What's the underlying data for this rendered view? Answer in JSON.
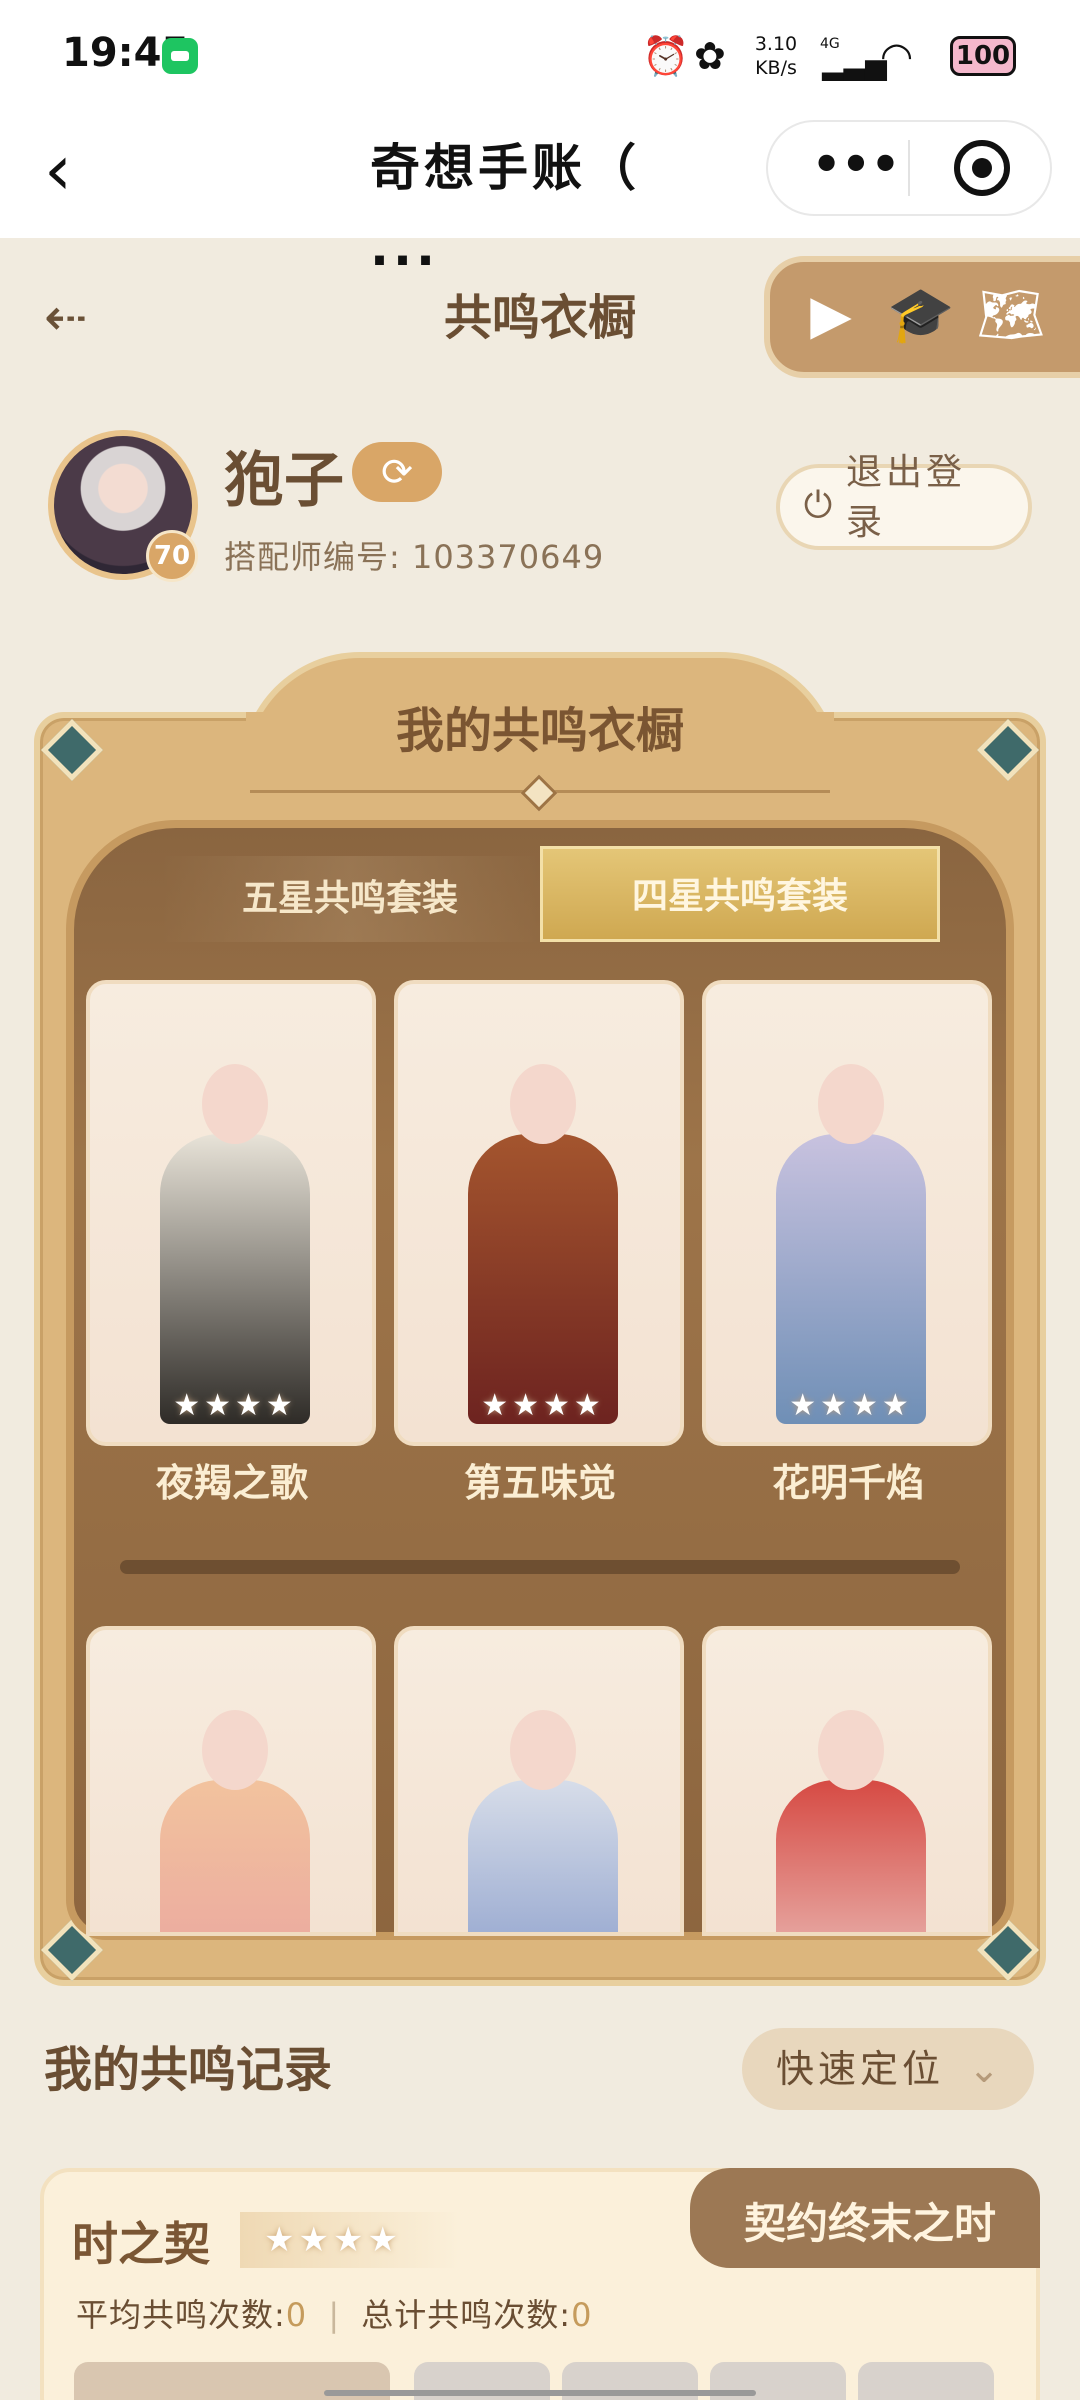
{
  "status_bar": {
    "time": "19:45",
    "net_speed": "3.10",
    "net_unit": "KB/s",
    "signal": "4G",
    "battery": "100",
    "icons": [
      "wechat-icon",
      "alarm-icon",
      "flower-icon",
      "signal-icon",
      "wifi-icon",
      "battery-icon"
    ]
  },
  "nav": {
    "back_symbol": "‹",
    "title": "奇想手账（ ...",
    "more_symbol": "•••"
  },
  "header": {
    "back_symbol": "⇠",
    "title": "共鸣衣橱",
    "tools": [
      "▶",
      "🎓",
      "🗺"
    ]
  },
  "profile": {
    "username": "狍子",
    "level": "70",
    "sync_symbol": "⟳",
    "stylist_id": "搭配师编号: 103370649",
    "logout_label": "退出登录",
    "power_symbol": "⏻"
  },
  "wardrobe": {
    "title": "我的共鸣衣橱",
    "tabs": [
      {
        "label": "五星共鸣套装",
        "active": false
      },
      {
        "label": "四星共鸣套装",
        "active": true
      }
    ],
    "star_text": "★★★★",
    "row1": [
      {
        "name": "夜羯之歌",
        "colors": [
          "#2e2b27",
          "#e8e3d8"
        ]
      },
      {
        "name": "第五味觉",
        "colors": [
          "#6d2320",
          "#a4552e"
        ]
      },
      {
        "name": "花明千焰",
        "colors": [
          "#6f8fb6",
          "#c8c2df"
        ]
      }
    ],
    "row2": [
      {
        "name": "",
        "colors": [
          "#e79aa0",
          "#f2c39e"
        ]
      },
      {
        "name": "",
        "colors": [
          "#6e86bf",
          "#d7dde9"
        ]
      },
      {
        "name": "",
        "colors": [
          "#f3eeea",
          "#d64a43"
        ]
      }
    ]
  },
  "records": {
    "title": "我的共鸣记录",
    "quick_locate": "快速定位",
    "chevron": "⌄",
    "item": {
      "name": "时之契",
      "stars": "★★★★",
      "tab_label": "契约终末之时",
      "avg_label": "平均共鸣次数:",
      "avg_value": "0",
      "sep": "|",
      "total_label": "总计共鸣次数:",
      "total_value": "0"
    }
  }
}
